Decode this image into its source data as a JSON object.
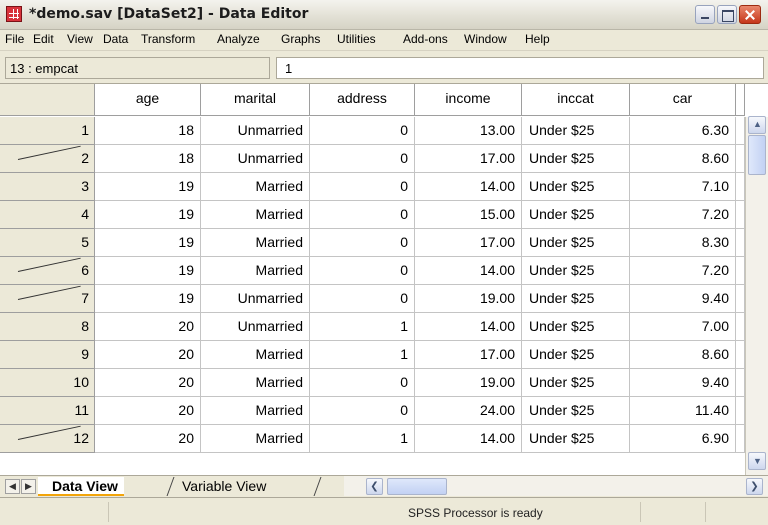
{
  "window": {
    "title": "*demo.sav [DataSet2] - Data Editor"
  },
  "menu": [
    "File",
    "Edit",
    "View",
    "Data",
    "Transform",
    "Analyze",
    "Graphs",
    "Utilities",
    "Add-ons",
    "Window",
    "Help"
  ],
  "cell_editor": {
    "reference": "13 : empcat",
    "value": "1"
  },
  "columns": [
    "age",
    "marital",
    "address",
    "income",
    "inccat",
    "car"
  ],
  "rows": [
    {
      "n": "1",
      "cells": [
        "18",
        "Unmarried",
        "0",
        "13.00",
        "Under $25",
        "6.30"
      ],
      "strike": false
    },
    {
      "n": "2",
      "cells": [
        "18",
        "Unmarried",
        "0",
        "17.00",
        "Under $25",
        "8.60"
      ],
      "strike": true
    },
    {
      "n": "3",
      "cells": [
        "19",
        "Married",
        "0",
        "14.00",
        "Under $25",
        "7.10"
      ],
      "strike": false
    },
    {
      "n": "4",
      "cells": [
        "19",
        "Married",
        "0",
        "15.00",
        "Under $25",
        "7.20"
      ],
      "strike": false
    },
    {
      "n": "5",
      "cells": [
        "19",
        "Married",
        "0",
        "17.00",
        "Under $25",
        "8.30"
      ],
      "strike": false
    },
    {
      "n": "6",
      "cells": [
        "19",
        "Married",
        "0",
        "14.00",
        "Under $25",
        "7.20"
      ],
      "strike": true
    },
    {
      "n": "7",
      "cells": [
        "19",
        "Unmarried",
        "0",
        "19.00",
        "Under $25",
        "9.40"
      ],
      "strike": true
    },
    {
      "n": "8",
      "cells": [
        "20",
        "Unmarried",
        "1",
        "14.00",
        "Under $25",
        "7.00"
      ],
      "strike": false
    },
    {
      "n": "9",
      "cells": [
        "20",
        "Married",
        "1",
        "17.00",
        "Under $25",
        "8.60"
      ],
      "strike": false
    },
    {
      "n": "10",
      "cells": [
        "20",
        "Married",
        "0",
        "19.00",
        "Under $25",
        "9.40"
      ],
      "strike": false
    },
    {
      "n": "11",
      "cells": [
        "20",
        "Married",
        "0",
        "24.00",
        "Under $25",
        "11.40"
      ],
      "strike": false
    },
    {
      "n": "12",
      "cells": [
        "20",
        "Married",
        "1",
        "14.00",
        "Under $25",
        "6.90"
      ],
      "strike": true
    }
  ],
  "tabs": {
    "data_view": "Data View",
    "variable_view": "Variable View"
  },
  "status": {
    "text": "SPSS Processor is ready"
  }
}
